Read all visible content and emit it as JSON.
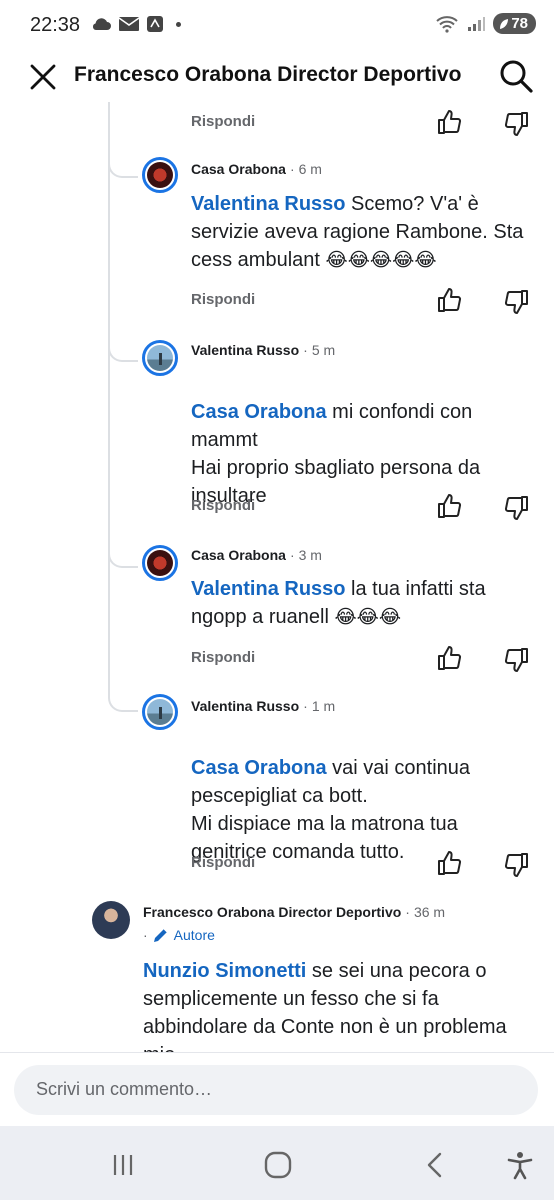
{
  "status_bar": {
    "time": "22:38",
    "battery": "78"
  },
  "header": {
    "title": "Francesco Orabona Director Deportivo"
  },
  "actions": {
    "reply_label": "Rispondi"
  },
  "comments": [
    {
      "author": "Casa Orabona",
      "time": "6 m",
      "mention": "Valentina Russo",
      "text": " Scemo? V'a' è servizie aveva ragione Rambone. Sta cess ambulant ",
      "emojis": "😂😂😂😂😂"
    },
    {
      "author": "Valentina Russo",
      "time": "5 m",
      "mention": "Casa Orabona",
      "text": " mi confondi con mammt\nHai proprio sbagliato persona da insultare",
      "emojis": ""
    },
    {
      "author": "Casa Orabona",
      "time": "3 m",
      "mention": "Valentina Russo",
      "text": " la tua infatti sta ngopp a ruanell ",
      "emojis": "😂😂😂"
    },
    {
      "author": "Valentina Russo",
      "time": "1 m",
      "mention": "Casa Orabona",
      "text": " vai vai continua pescepigliat ca bott.\nMi dispiace ma la matrona tua genitrice comanda tutto.",
      "emojis": ""
    },
    {
      "author": "Francesco Orabona Director Deportivo",
      "time": "36 m",
      "badge": "Autore",
      "mention": "Nunzio Simonetti",
      "text": " se sei una pecora o semplicemente un fesso che si fa abbindolare da Conte non è un problema mio",
      "emojis": ""
    }
  ],
  "composer": {
    "placeholder": "Scrivi un commento…"
  },
  "colors": {
    "accent": "#1b74e4",
    "mention": "#1566c0",
    "muted": "#65676b"
  }
}
